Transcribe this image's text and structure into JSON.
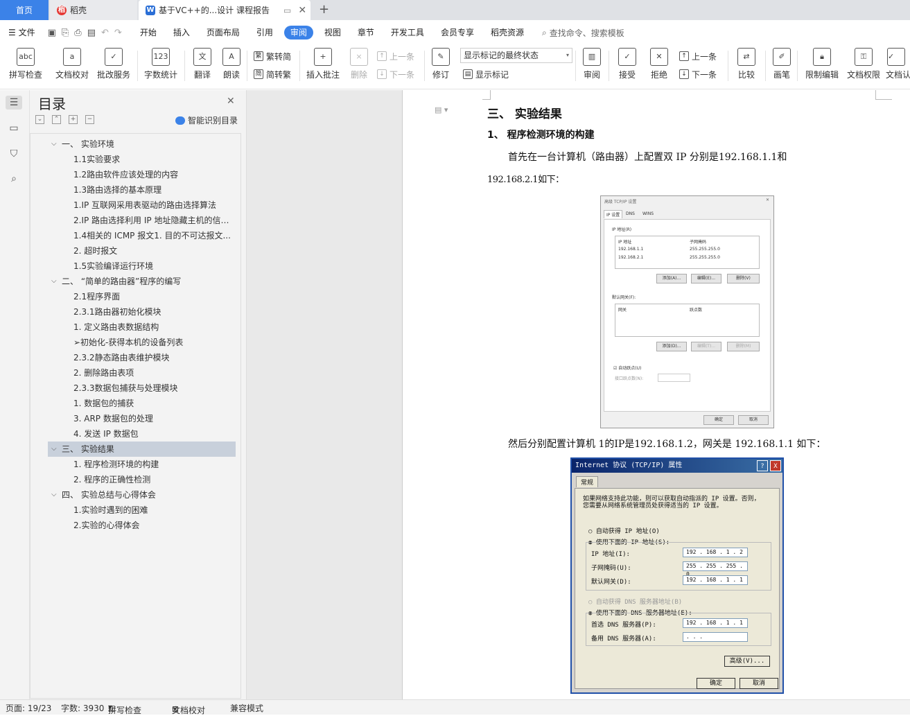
{
  "tabs": {
    "home": "首页",
    "daoke": "稻壳",
    "doc": "基于VC++的...设计 课程报告",
    "new_tab": "+"
  },
  "menu": {
    "file": "文件",
    "items": [
      "开始",
      "插入",
      "页面布局",
      "引用",
      "审阅",
      "视图",
      "章节",
      "开发工具",
      "会员专享",
      "稻壳资源"
    ],
    "active": "审阅",
    "search": "查找命令、搜索模板"
  },
  "ribbon": {
    "spellcheck": "拼写检查",
    "doccheck": "文档校对",
    "revise_service": "批改服务",
    "wordcount": "字数统计",
    "translate": "翻译",
    "read_aloud": "朗读",
    "trad_to_simp": "繁转简",
    "simp_to_trad": "简转繁",
    "insert_comment": "插入批注",
    "delete": "删除",
    "prev": "上一条",
    "next": "下一条",
    "track": "修订",
    "track_select": "显示标记的最终状态",
    "show_markup": "显示标记",
    "review": "审阅",
    "accept": "接受",
    "reject": "拒绝",
    "prev2": "上一条",
    "next2": "下一条",
    "compare": "比较",
    "pen": "画笔",
    "restrict_edit": "限制编辑",
    "doc_perm": "文档权限",
    "doc_auth": "文档认"
  },
  "toc": {
    "title": "目录",
    "smart": "智能识别目录",
    "items": [
      {
        "text": "一、 实验环境",
        "level": 1,
        "expand": "v"
      },
      {
        "text": "1.1实验要求",
        "level": 2
      },
      {
        "text": "1.2路由软件应该处理的内容",
        "level": 2
      },
      {
        "text": "1.3路由选择的基本原理",
        "level": 2
      },
      {
        "text": "1.IP 互联网采用表驱动的路由选择算法",
        "level": 2
      },
      {
        "text": "2.IP 路由选择利用 IP 地址隐藏主机的信息...",
        "level": 2
      },
      {
        "text": "1.4相关的 ICMP 报文1. 目的不可达报文...",
        "level": 2
      },
      {
        "text": "2. 超时报文",
        "level": 2
      },
      {
        "text": "1.5实验编译运行环境",
        "level": 2
      },
      {
        "text": "二、 “简单的路由器”程序的编写",
        "level": 1,
        "expand": "v"
      },
      {
        "text": "2.1程序界面",
        "level": 2
      },
      {
        "text": "2.3.1路由器初始化模块",
        "level": 2
      },
      {
        "text": "1. 定义路由表数据结构",
        "level": 2
      },
      {
        "text": "➢初始化-获得本机的设备列表",
        "level": 2
      },
      {
        "text": "2.3.2静态路由表维护模块",
        "level": 2
      },
      {
        "text": "2. 删除路由表项",
        "level": 2
      },
      {
        "text": "2.3.3数据包捕获与处理模块",
        "level": 2
      },
      {
        "text": "1. 数据包的捕获",
        "level": 2
      },
      {
        "text": "3. ARP 数据包的处理",
        "level": 2
      },
      {
        "text": "4. 发送 IP 数据包",
        "level": 2
      },
      {
        "text": "三、 实验结果",
        "level": 1,
        "expand": "v",
        "selected": true
      },
      {
        "text": "1. 程序检测环境的构建",
        "level": 2
      },
      {
        "text": "2. 程序的正确性检测",
        "level": 2
      },
      {
        "text": "四、 实验总结与心得体会",
        "level": 1,
        "expand": "v"
      },
      {
        "text": "1.实验时遇到的困难",
        "level": 2
      },
      {
        "text": "2.实验的心得体会",
        "level": 2
      }
    ]
  },
  "doc": {
    "h1": "三、  实验结果",
    "h2": "1、 程序检测环境的构建",
    "p1a": "首先在一台计算机（路由器）上配置双 IP 分别是192.168.1.1和",
    "p1b": "192.168.2.1如下：",
    "p2": "然后分别配置计算机 1的IP是192.168.1.2，网关是 192.168.1.1 如下："
  },
  "shot1": {
    "title": "高级 TCP/IP 设置",
    "tabs": [
      "IP 设置",
      "DNS",
      "WINS"
    ],
    "ip_group": "IP 地址(R)",
    "col_ip": "IP 地址",
    "col_mask": "子网掩码",
    "rows": [
      [
        "192.168.1.1",
        "255.255.255.0"
      ],
      [
        "192.168.2.1",
        "255.255.255.0"
      ]
    ],
    "add": "添加(A)...",
    "edit": "编辑(E)...",
    "remove": "删除(V)",
    "gw_group": "默认网关(F):",
    "col_gw": "网关",
    "col_metric": "跃点数",
    "add2": "添加(D)...",
    "edit2": "编辑(T)...",
    "remove2": "删除(M)",
    "auto_metric": "自动跃点(U)",
    "iface_metric": "接口跃点数(N):",
    "ok": "确定",
    "cancel": "取消"
  },
  "shot2": {
    "title": "Internet 协议 (TCP/IP) 属性",
    "tab": "常规",
    "desc1": "如果网络支持此功能，则可以获取自动指派的 IP 设置。否则，",
    "desc2": "您需要从网络系统管理员处获得适当的 IP 设置。",
    "auto_ip": "自动获得 IP 地址(O)",
    "use_ip": "使用下面的 IP 地址(S):",
    "ip_label": "IP 地址(I):",
    "ip_val": "192 . 168 .  1  .  2",
    "mask_label": "子网掩码(U):",
    "mask_val": "255 . 255 . 255 .  0",
    "gw_label": "默认网关(D):",
    "gw_val": "192 . 168 .  1  .  1",
    "auto_dns": "自动获得 DNS 服务器地址(B)",
    "use_dns": "使用下面的 DNS 服务器地址(E):",
    "dns1_label": "首选 DNS 服务器(P):",
    "dns1_val": "192 . 168 .  1  .  1",
    "dns2_label": "备用 DNS 服务器(A):",
    "dns2_val": " .     .     .",
    "advanced": "高级(V)...",
    "ok": "确定",
    "cancel": "取消",
    "help": "?",
    "close": "X"
  },
  "status": {
    "page": "页面: 19/23",
    "words": "字数: 3930",
    "spell": "拼写检查",
    "check": "文档校对",
    "compat": "兼容模式"
  },
  "colors": {
    "accent": "#3b82e8",
    "selected": "#c8d0db"
  }
}
